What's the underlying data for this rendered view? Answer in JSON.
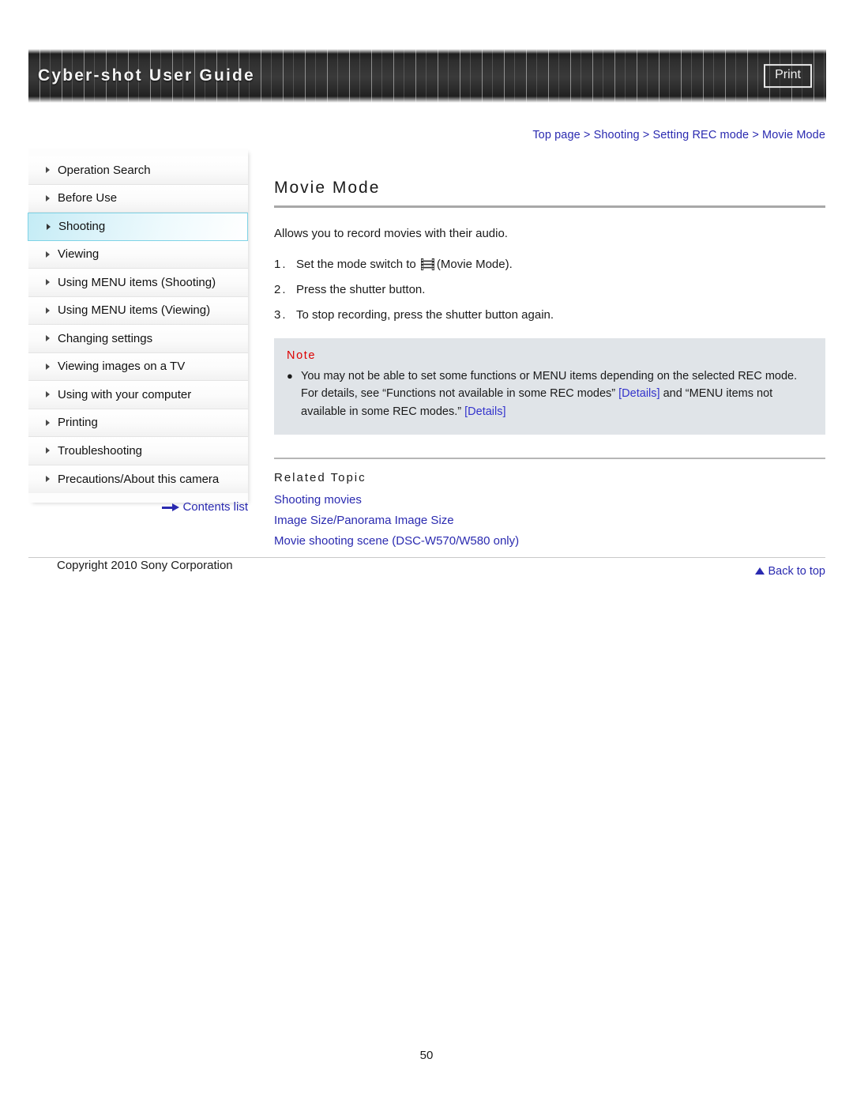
{
  "header": {
    "title": "Cyber-shot User Guide",
    "print_label": "Print"
  },
  "breadcrumb": {
    "items": [
      "Top page",
      "Shooting",
      "Setting REC mode",
      "Movie Mode"
    ],
    "separator": ">",
    "full_text": "Top page > Shooting > Setting REC mode > Movie Mode"
  },
  "sidebar": {
    "items": [
      {
        "label": "Operation Search",
        "active": false
      },
      {
        "label": "Before Use",
        "active": false
      },
      {
        "label": "Shooting",
        "active": true
      },
      {
        "label": "Viewing",
        "active": false
      },
      {
        "label": "Using MENU items (Shooting)",
        "active": false
      },
      {
        "label": "Using MENU items (Viewing)",
        "active": false
      },
      {
        "label": "Changing settings",
        "active": false
      },
      {
        "label": "Viewing images on a TV",
        "active": false
      },
      {
        "label": "Using with your computer",
        "active": false
      },
      {
        "label": "Printing",
        "active": false
      },
      {
        "label": "Troubleshooting",
        "active": false
      },
      {
        "label": "Precautions/About this camera",
        "active": false
      }
    ],
    "contents_list_label": "Contents list"
  },
  "main": {
    "title": "Movie Mode",
    "intro": "Allows you to record movies with their audio.",
    "steps": [
      {
        "num": "1.",
        "text_before": "Set the mode switch to ",
        "icon": "film-strip-icon",
        "text_after": "(Movie Mode)."
      },
      {
        "num": "2.",
        "text_before": "Press the shutter button.",
        "icon": null,
        "text_after": ""
      },
      {
        "num": "3.",
        "text_before": "To stop recording, press the shutter button again.",
        "icon": null,
        "text_after": ""
      }
    ],
    "note": {
      "label": "Note",
      "bullet": "●",
      "text_part1": "You may not be able to set some functions or MENU items depending on the selected REC mode. For details, see “Functions not available in some REC modes” ",
      "link1": "[Details]",
      "text_part2": " and “MENU items not available in some REC modes.” ",
      "link2": "[Details]"
    },
    "related_topic": {
      "label": "Related Topic",
      "links": [
        "Shooting movies",
        "Image Size/Panorama Image Size",
        "Movie shooting scene (DSC-W570/W580 only)"
      ]
    },
    "back_to_top_label": "Back to top"
  },
  "footer": {
    "copyright": "Copyright 2010 Sony Corporation",
    "page_number": "50"
  },
  "colors": {
    "link": "#2a2ab0",
    "note_label": "#dd0000",
    "note_bg": "#e0e4e8",
    "active_nav": "#7fd3e6",
    "header_bg": "#303030"
  }
}
